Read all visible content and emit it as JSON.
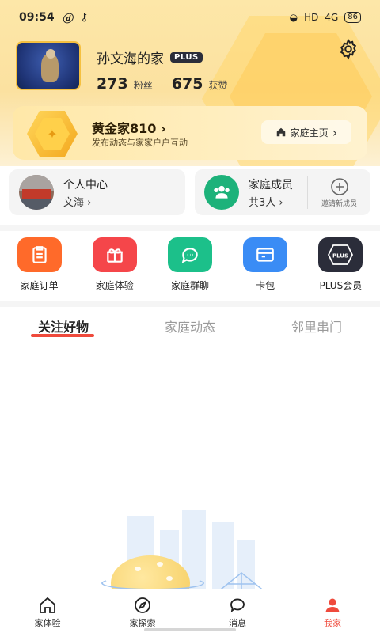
{
  "status_bar": {
    "time": "09:54",
    "network": "HD",
    "signal": "4G",
    "battery": "86"
  },
  "profile": {
    "home_name": "孙文海的家",
    "plus_badge": "PLUS",
    "fans_count": "273",
    "fans_label": "粉丝",
    "likes_count": "675",
    "likes_label": "获赞"
  },
  "level_card": {
    "title": "黄金家810",
    "subtitle": "发布动态与家家户户互动",
    "home_button": "家庭主页"
  },
  "personal_card": {
    "title": "个人中心",
    "subtitle": "文海"
  },
  "family_card": {
    "title": "家庭成员",
    "subtitle": "共3人",
    "invite_label": "邀请新成员"
  },
  "actions": [
    {
      "label": "家庭订单",
      "icon": "clipboard-icon",
      "color": "#ff6a2a"
    },
    {
      "label": "家庭体验",
      "icon": "gift-icon",
      "color": "#f5464a"
    },
    {
      "label": "家庭群聊",
      "icon": "chat-icon",
      "color": "#1cc08a"
    },
    {
      "label": "卡包",
      "icon": "wallet-icon",
      "color": "#3a8cf5"
    },
    {
      "label": "PLUS会员",
      "icon": "plus-badge-icon",
      "color": "#2b2d3a"
    }
  ],
  "tabs": [
    {
      "label": "关注好物",
      "active": true
    },
    {
      "label": "家庭动态",
      "active": false
    },
    {
      "label": "邻里串门",
      "active": false
    }
  ],
  "bottom_nav": [
    {
      "label": "家体验",
      "icon": "house-icon",
      "active": false
    },
    {
      "label": "家探索",
      "icon": "compass-icon",
      "active": false
    },
    {
      "label": "消息",
      "icon": "message-icon",
      "active": false
    },
    {
      "label": "我家",
      "icon": "user-icon",
      "active": true
    }
  ],
  "colors": {
    "accent": "#ef4a3c",
    "gold": "#f5c040"
  }
}
